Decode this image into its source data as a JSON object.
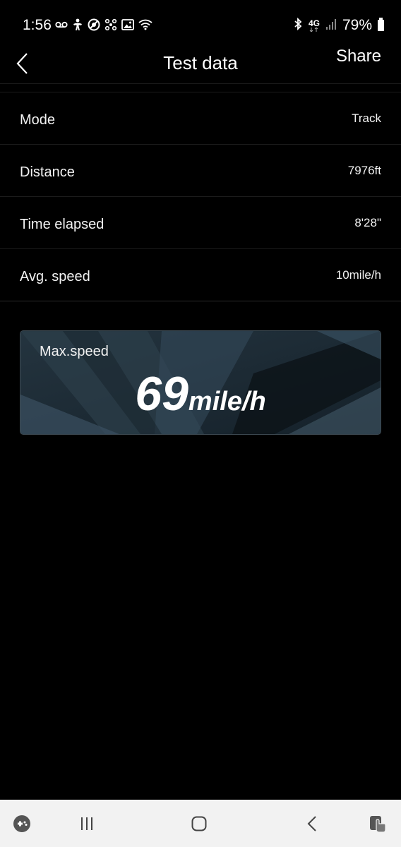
{
  "status_bar": {
    "time": "1:56",
    "battery_percent": "79%",
    "icons_left": [
      "voicemail-icon",
      "accessibility-icon",
      "do-not-disturb-icon",
      "bluetooth-share-icon",
      "gallery-icon",
      "wifi-icon"
    ],
    "icons_right": [
      "bluetooth-icon",
      "4g-lte-icon",
      "signal-icon",
      "battery-icon"
    ],
    "network_label": "4G"
  },
  "header": {
    "title": "Test data",
    "share_label": "Share"
  },
  "rows": [
    {
      "label": "Mode",
      "value": "Track"
    },
    {
      "label": "Distance",
      "value": "7976ft"
    },
    {
      "label": "Time elapsed",
      "value": "8'28\""
    },
    {
      "label": "Avg. speed",
      "value": "10mile/h"
    }
  ],
  "max_speed": {
    "label": "Max.speed",
    "value": "69",
    "unit": "mile/h"
  },
  "nav_bar": {
    "items": [
      "game-launcher-icon",
      "recent-apps-icon",
      "home-icon",
      "back-icon",
      "assistant-icon"
    ]
  },
  "colors": {
    "background": "#000000",
    "text": "#ffffff",
    "card_bg": "#1c2a33",
    "nav_bg": "#f2f2f2"
  }
}
